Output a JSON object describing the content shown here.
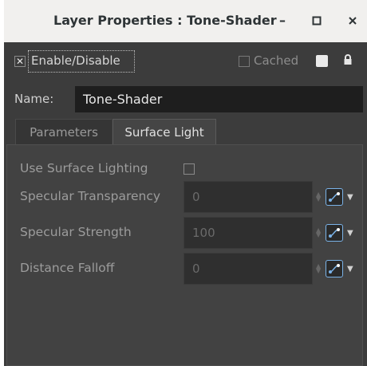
{
  "window": {
    "title": "Layer Properties : Tone-Shader",
    "minimize_glyph": "–",
    "maximize_glyph": "□",
    "close_glyph": "✕"
  },
  "header": {
    "enable_label": "Enable/Disable",
    "enable_checked": true,
    "cached_label": "Cached",
    "cached_checked": false,
    "lock_icon": "lock-icon"
  },
  "name": {
    "label": "Name:",
    "value": "Tone-Shader"
  },
  "tabs": [
    {
      "label": "Parameters",
      "active": false
    },
    {
      "label": "Surface Light",
      "active": true
    }
  ],
  "surface_light": {
    "use_surface_lighting_label": "Use Surface Lighting",
    "use_surface_lighting_checked": false,
    "fields": [
      {
        "label": "Specular Transparency",
        "value": "0"
      },
      {
        "label": "Specular Strength",
        "value": "100"
      },
      {
        "label": "Distance Falloff",
        "value": "0"
      }
    ]
  },
  "colors": {
    "accent": "#7ab3e8",
    "background": "#3c3c3c",
    "field_bg": "#1e1e1e"
  }
}
